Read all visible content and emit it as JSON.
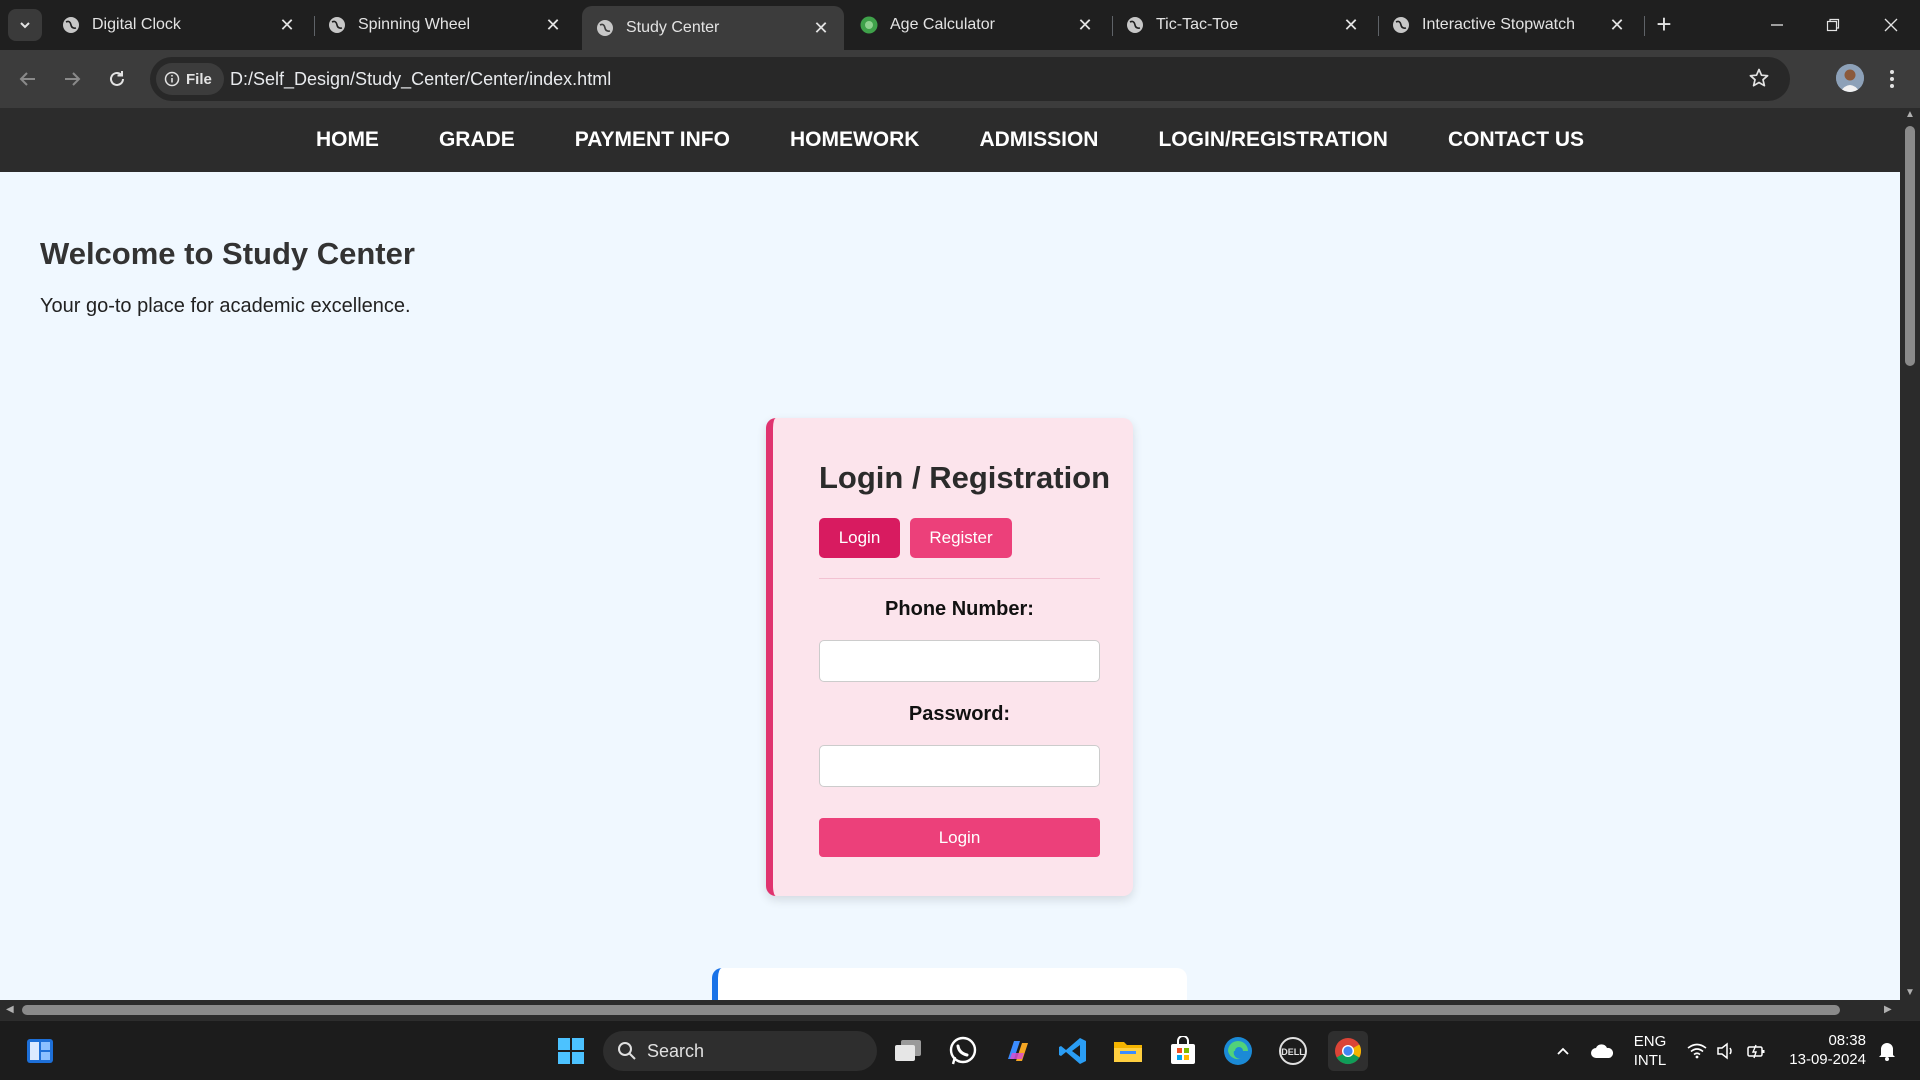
{
  "browser": {
    "tabs": [
      {
        "title": "Digital Clock",
        "active": false
      },
      {
        "title": "Spinning Wheel",
        "active": false
      },
      {
        "title": "Study Center",
        "active": true
      },
      {
        "title": "Age Calculator",
        "active": false
      },
      {
        "title": "Tic-Tac-Toe",
        "active": false
      },
      {
        "title": "Interactive Stopwatch",
        "active": false
      }
    ],
    "chip_label": "File",
    "url": "D:/Self_Design/Study_Center/Center/index.html"
  },
  "site": {
    "nav": [
      "HOME",
      "GRADE",
      "PAYMENT INFO",
      "HOMEWORK",
      "ADMISSION",
      "LOGIN/REGISTRATION",
      "CONTACT US"
    ],
    "welcome_title": "Welcome to Study Center",
    "welcome_sub": "Your go-to place for academic excellence.",
    "auth": {
      "title": "Login / Registration",
      "login_tab": "Login",
      "register_tab": "Register",
      "phone_label": "Phone Number:",
      "phone_value": "",
      "password_label": "Password:",
      "password_value": "",
      "submit": "Login"
    }
  },
  "taskbar": {
    "search_label": "Search",
    "lang_line1": "ENG",
    "lang_line2": "INTL",
    "time": "08:38",
    "date": "13-09-2024"
  },
  "colors": {
    "accent_pink": "#e0336f",
    "login_pill": "#d81b60",
    "register_pill": "#ec407a",
    "card_bg": "#fce4ec",
    "page_bg": "#f0f8ff",
    "nav_bg": "#2c2c2c"
  }
}
